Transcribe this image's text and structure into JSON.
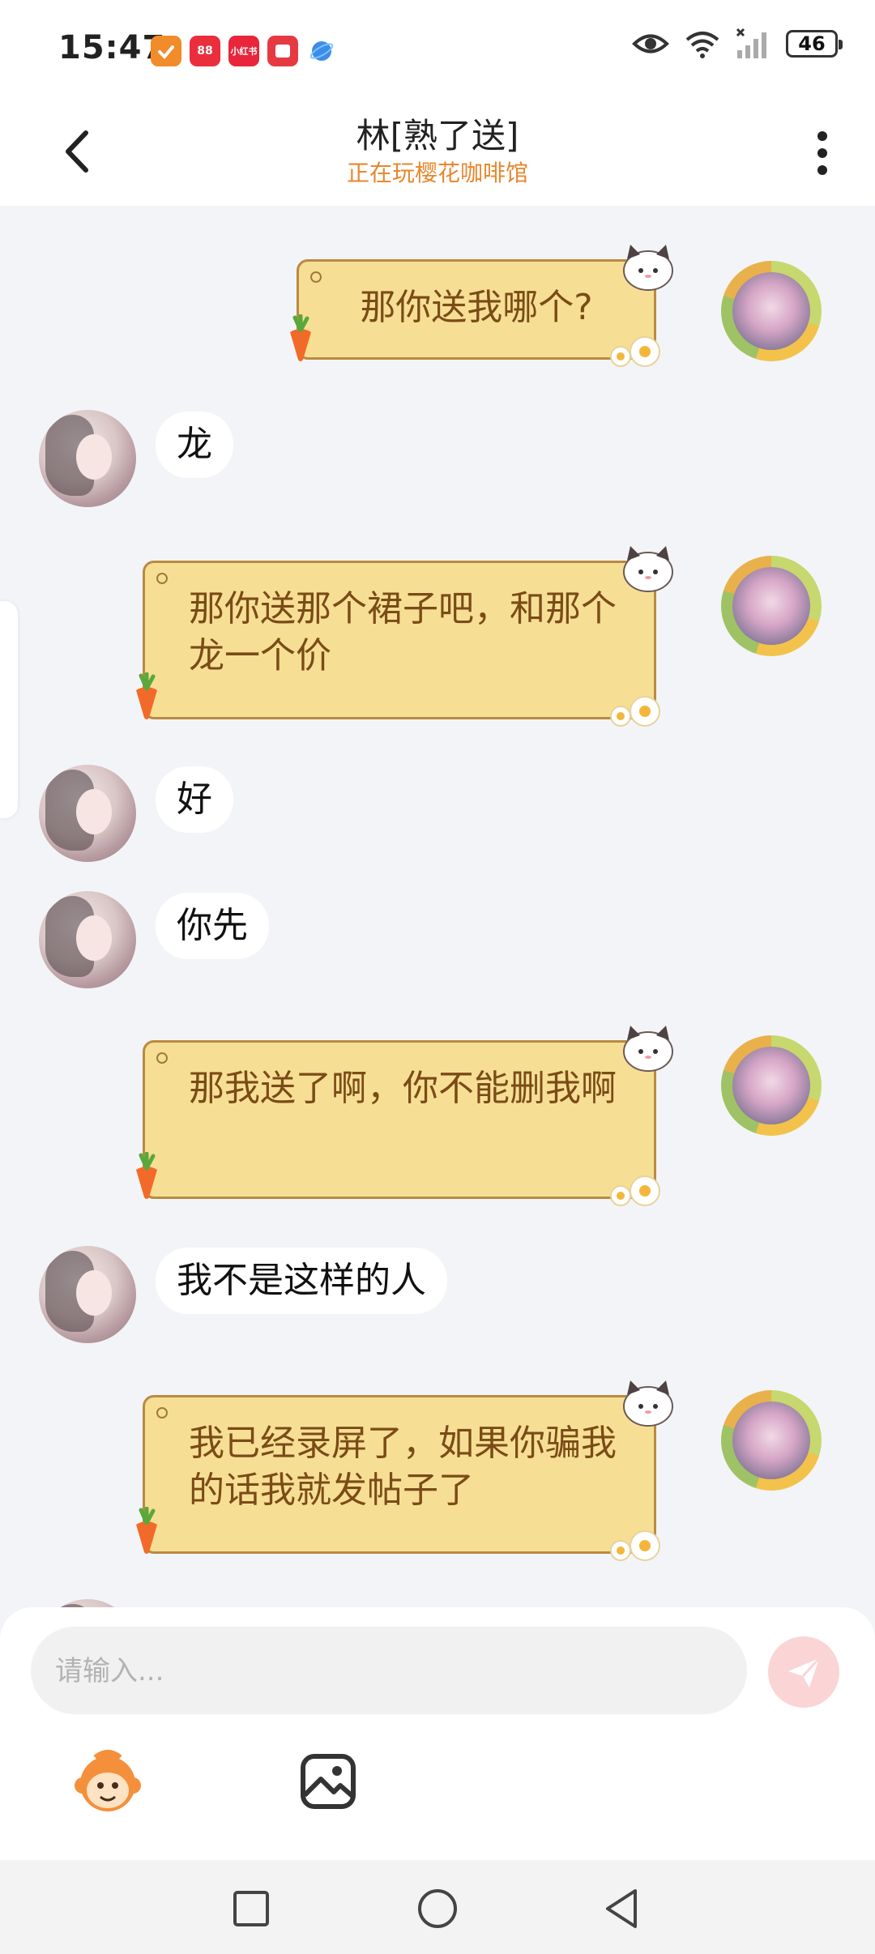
{
  "status_bar": {
    "time": "15:47",
    "battery": "46",
    "notification_apps": [
      {
        "icon": "app-orange-icon",
        "color": "#f28b2a",
        "text": ""
      },
      {
        "icon": "app-red-88-icon",
        "color": "#ea2e3c",
        "text": "88"
      },
      {
        "icon": "app-xiaohongshu-icon",
        "color": "#e8253a",
        "text": "小红书"
      },
      {
        "icon": "app-red-square-icon",
        "color": "#e63a43",
        "text": ""
      },
      {
        "icon": "app-blue-orb-icon",
        "color": "#3c8de8",
        "text": ""
      }
    ]
  },
  "header": {
    "title": "林[熟了送]",
    "subtitle": "正在玩樱花咖啡馆",
    "subtitle_color": "#e8872e"
  },
  "messages": [
    {
      "side": "right",
      "text": "那你送我哪个?"
    },
    {
      "side": "left",
      "text": "龙"
    },
    {
      "side": "right",
      "text": "那你送那个裙子吧，和那个龙一个价"
    },
    {
      "side": "left",
      "text": "好"
    },
    {
      "side": "left",
      "text": "你先"
    },
    {
      "side": "right",
      "text": "那我送了啊，你不能删我啊"
    },
    {
      "side": "left",
      "text": "我不是这样的人"
    },
    {
      "side": "right",
      "text": "我已经录屏了，如果你骗我的话我就发帖子了"
    }
  ],
  "input": {
    "placeholder": "请输入..."
  },
  "toolbar": {
    "emoji_icon": "monkey-emoji-icon",
    "image_icon": "image-icon"
  },
  "colors": {
    "bubble_right": "#f6df94",
    "bubble_right_text": "#7a4b17",
    "background": "#f3f4f8"
  }
}
